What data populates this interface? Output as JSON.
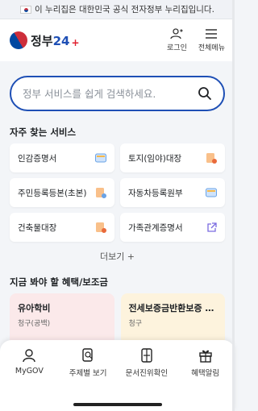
{
  "banner": {
    "text": "이 누리집은 대한민국 공식 전자정부 누리집입니다."
  },
  "header": {
    "logo_text": "정부",
    "logo_24": "24",
    "logo_plus": "+",
    "login_label": "로그인",
    "menu_label": "전체메뉴"
  },
  "search": {
    "placeholder": "정부 서비스를 쉽게 검색하세요."
  },
  "frequent": {
    "title": "자주 찾는 서비스",
    "items": [
      {
        "label": "인감증명서"
      },
      {
        "label": "토지(임야)대장"
      },
      {
        "label": "주민등록등본(초본)"
      },
      {
        "label": "자동차등록원부"
      },
      {
        "label": "건축물대장"
      },
      {
        "label": "가족관계증명서"
      }
    ],
    "more_label": "더보기 +"
  },
  "benefits": {
    "title": "지금 봐야 할 혜택/보조금",
    "items": [
      {
        "title": "유아학비",
        "sub": "청구(공백)"
      },
      {
        "title": "전세보증금반환보증 …",
        "sub": "청구"
      }
    ]
  },
  "bottom_nav": [
    {
      "label": "MyGOV"
    },
    {
      "label": "주제별 보기"
    },
    {
      "label": "문서진위확인"
    },
    {
      "label": "혜택알림"
    }
  ],
  "colors": {
    "accent": "#1e4fb5",
    "benefit1": "#fbe9ea",
    "benefit2": "#fdf3dd"
  }
}
